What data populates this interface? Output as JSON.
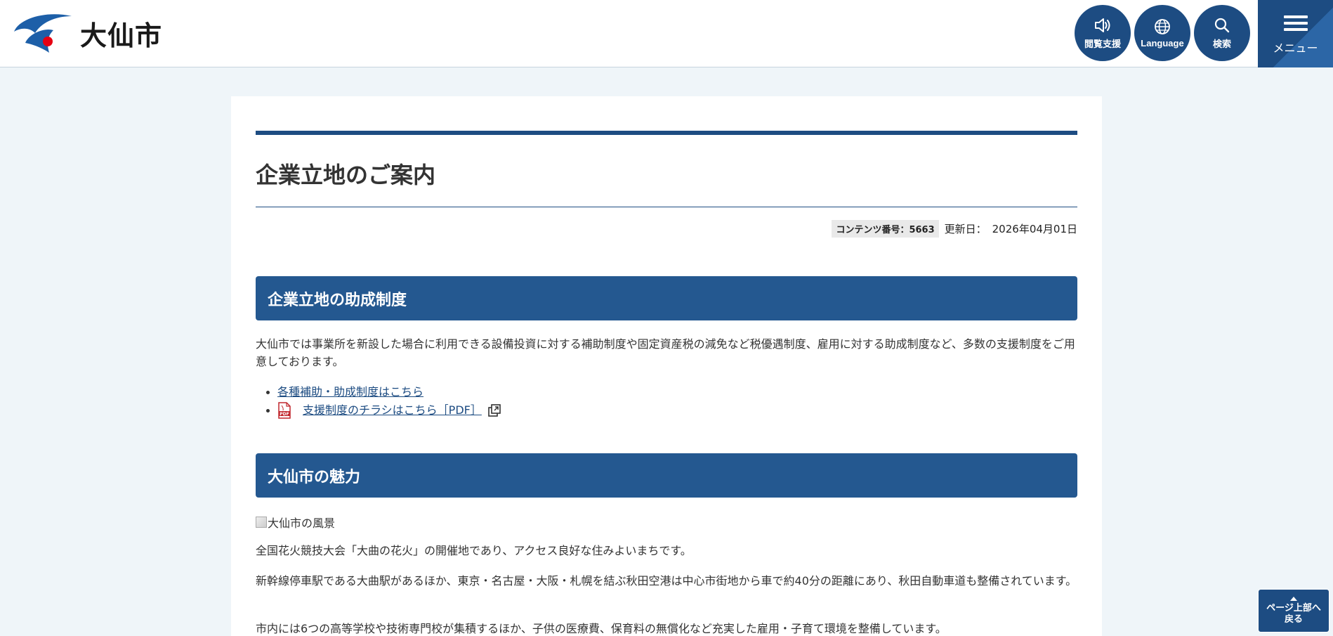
{
  "header": {
    "logo_text": "大仙市",
    "buttons": {
      "reading_support": "閲覧支援",
      "language": "Language",
      "search": "検索",
      "menu": "メニュー"
    }
  },
  "page": {
    "title": "企業立地のご案内",
    "content_number": "コンテンツ番号：5663",
    "updated_label": "更新日：",
    "updated_date": "2026年04月01日"
  },
  "sections": [
    {
      "heading": "企業立地の助成制度",
      "body": "大仙市では事業所を新設した場合に利用できる設備投資に対する補助制度や固定資産税の減免など税優遇制度、雇用に対する助成制度など、多数の支援制度をご用意しております。",
      "links": [
        "各種補助・助成制度はこちら",
        "支援制度のチラシはこちら［PDF］"
      ]
    },
    {
      "heading": "大仙市の魅力",
      "image_alt": "大仙市の風景",
      "paragraphs": [
        "全国花火競技大会「大曲の花火」の開催地であり、アクセス良好な住みよいまちです。",
        "新幹線停車駅である大曲駅があるほか、東京・名古屋・大阪・札幌を結ぶ秋田空港は中心市街地から車で約40分の距離にあり、秋田自動車道も整備されています。",
        "市内には6つの高等学校や技術専門校が集積するほか、子供の医療費、保育料の無償化など充実した雇用・子育て環境を整備しています。"
      ]
    }
  ],
  "page_top": {
    "label_line1": "ページ上部へ",
    "label_line2": "戻る"
  },
  "colors": {
    "primary": "#1d4c82",
    "section_heading": "#245890",
    "background": "#eff5f9",
    "logo_red": "#e60012"
  }
}
